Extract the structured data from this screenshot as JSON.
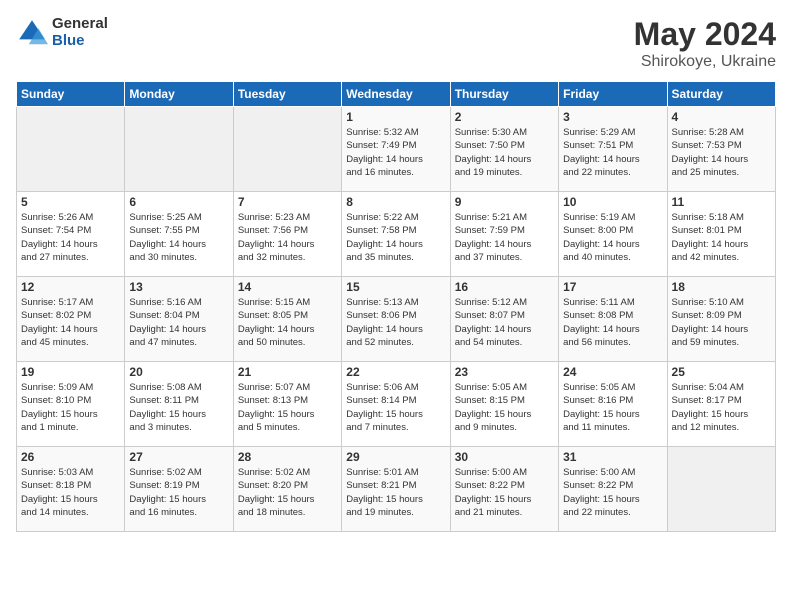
{
  "logo": {
    "general": "General",
    "blue": "Blue"
  },
  "title": {
    "month": "May 2024",
    "location": "Shirokoye, Ukraine"
  },
  "weekdays": [
    "Sunday",
    "Monday",
    "Tuesday",
    "Wednesday",
    "Thursday",
    "Friday",
    "Saturday"
  ],
  "weeks": [
    [
      {
        "day": "",
        "info": ""
      },
      {
        "day": "",
        "info": ""
      },
      {
        "day": "",
        "info": ""
      },
      {
        "day": "1",
        "info": "Sunrise: 5:32 AM\nSunset: 7:49 PM\nDaylight: 14 hours\nand 16 minutes."
      },
      {
        "day": "2",
        "info": "Sunrise: 5:30 AM\nSunset: 7:50 PM\nDaylight: 14 hours\nand 19 minutes."
      },
      {
        "day": "3",
        "info": "Sunrise: 5:29 AM\nSunset: 7:51 PM\nDaylight: 14 hours\nand 22 minutes."
      },
      {
        "day": "4",
        "info": "Sunrise: 5:28 AM\nSunset: 7:53 PM\nDaylight: 14 hours\nand 25 minutes."
      }
    ],
    [
      {
        "day": "5",
        "info": "Sunrise: 5:26 AM\nSunset: 7:54 PM\nDaylight: 14 hours\nand 27 minutes."
      },
      {
        "day": "6",
        "info": "Sunrise: 5:25 AM\nSunset: 7:55 PM\nDaylight: 14 hours\nand 30 minutes."
      },
      {
        "day": "7",
        "info": "Sunrise: 5:23 AM\nSunset: 7:56 PM\nDaylight: 14 hours\nand 32 minutes."
      },
      {
        "day": "8",
        "info": "Sunrise: 5:22 AM\nSunset: 7:58 PM\nDaylight: 14 hours\nand 35 minutes."
      },
      {
        "day": "9",
        "info": "Sunrise: 5:21 AM\nSunset: 7:59 PM\nDaylight: 14 hours\nand 37 minutes."
      },
      {
        "day": "10",
        "info": "Sunrise: 5:19 AM\nSunset: 8:00 PM\nDaylight: 14 hours\nand 40 minutes."
      },
      {
        "day": "11",
        "info": "Sunrise: 5:18 AM\nSunset: 8:01 PM\nDaylight: 14 hours\nand 42 minutes."
      }
    ],
    [
      {
        "day": "12",
        "info": "Sunrise: 5:17 AM\nSunset: 8:02 PM\nDaylight: 14 hours\nand 45 minutes."
      },
      {
        "day": "13",
        "info": "Sunrise: 5:16 AM\nSunset: 8:04 PM\nDaylight: 14 hours\nand 47 minutes."
      },
      {
        "day": "14",
        "info": "Sunrise: 5:15 AM\nSunset: 8:05 PM\nDaylight: 14 hours\nand 50 minutes."
      },
      {
        "day": "15",
        "info": "Sunrise: 5:13 AM\nSunset: 8:06 PM\nDaylight: 14 hours\nand 52 minutes."
      },
      {
        "day": "16",
        "info": "Sunrise: 5:12 AM\nSunset: 8:07 PM\nDaylight: 14 hours\nand 54 minutes."
      },
      {
        "day": "17",
        "info": "Sunrise: 5:11 AM\nSunset: 8:08 PM\nDaylight: 14 hours\nand 56 minutes."
      },
      {
        "day": "18",
        "info": "Sunrise: 5:10 AM\nSunset: 8:09 PM\nDaylight: 14 hours\nand 59 minutes."
      }
    ],
    [
      {
        "day": "19",
        "info": "Sunrise: 5:09 AM\nSunset: 8:10 PM\nDaylight: 15 hours\nand 1 minute."
      },
      {
        "day": "20",
        "info": "Sunrise: 5:08 AM\nSunset: 8:11 PM\nDaylight: 15 hours\nand 3 minutes."
      },
      {
        "day": "21",
        "info": "Sunrise: 5:07 AM\nSunset: 8:13 PM\nDaylight: 15 hours\nand 5 minutes."
      },
      {
        "day": "22",
        "info": "Sunrise: 5:06 AM\nSunset: 8:14 PM\nDaylight: 15 hours\nand 7 minutes."
      },
      {
        "day": "23",
        "info": "Sunrise: 5:05 AM\nSunset: 8:15 PM\nDaylight: 15 hours\nand 9 minutes."
      },
      {
        "day": "24",
        "info": "Sunrise: 5:05 AM\nSunset: 8:16 PM\nDaylight: 15 hours\nand 11 minutes."
      },
      {
        "day": "25",
        "info": "Sunrise: 5:04 AM\nSunset: 8:17 PM\nDaylight: 15 hours\nand 12 minutes."
      }
    ],
    [
      {
        "day": "26",
        "info": "Sunrise: 5:03 AM\nSunset: 8:18 PM\nDaylight: 15 hours\nand 14 minutes."
      },
      {
        "day": "27",
        "info": "Sunrise: 5:02 AM\nSunset: 8:19 PM\nDaylight: 15 hours\nand 16 minutes."
      },
      {
        "day": "28",
        "info": "Sunrise: 5:02 AM\nSunset: 8:20 PM\nDaylight: 15 hours\nand 18 minutes."
      },
      {
        "day": "29",
        "info": "Sunrise: 5:01 AM\nSunset: 8:21 PM\nDaylight: 15 hours\nand 19 minutes."
      },
      {
        "day": "30",
        "info": "Sunrise: 5:00 AM\nSunset: 8:22 PM\nDaylight: 15 hours\nand 21 minutes."
      },
      {
        "day": "31",
        "info": "Sunrise: 5:00 AM\nSunset: 8:22 PM\nDaylight: 15 hours\nand 22 minutes."
      },
      {
        "day": "",
        "info": ""
      }
    ]
  ]
}
